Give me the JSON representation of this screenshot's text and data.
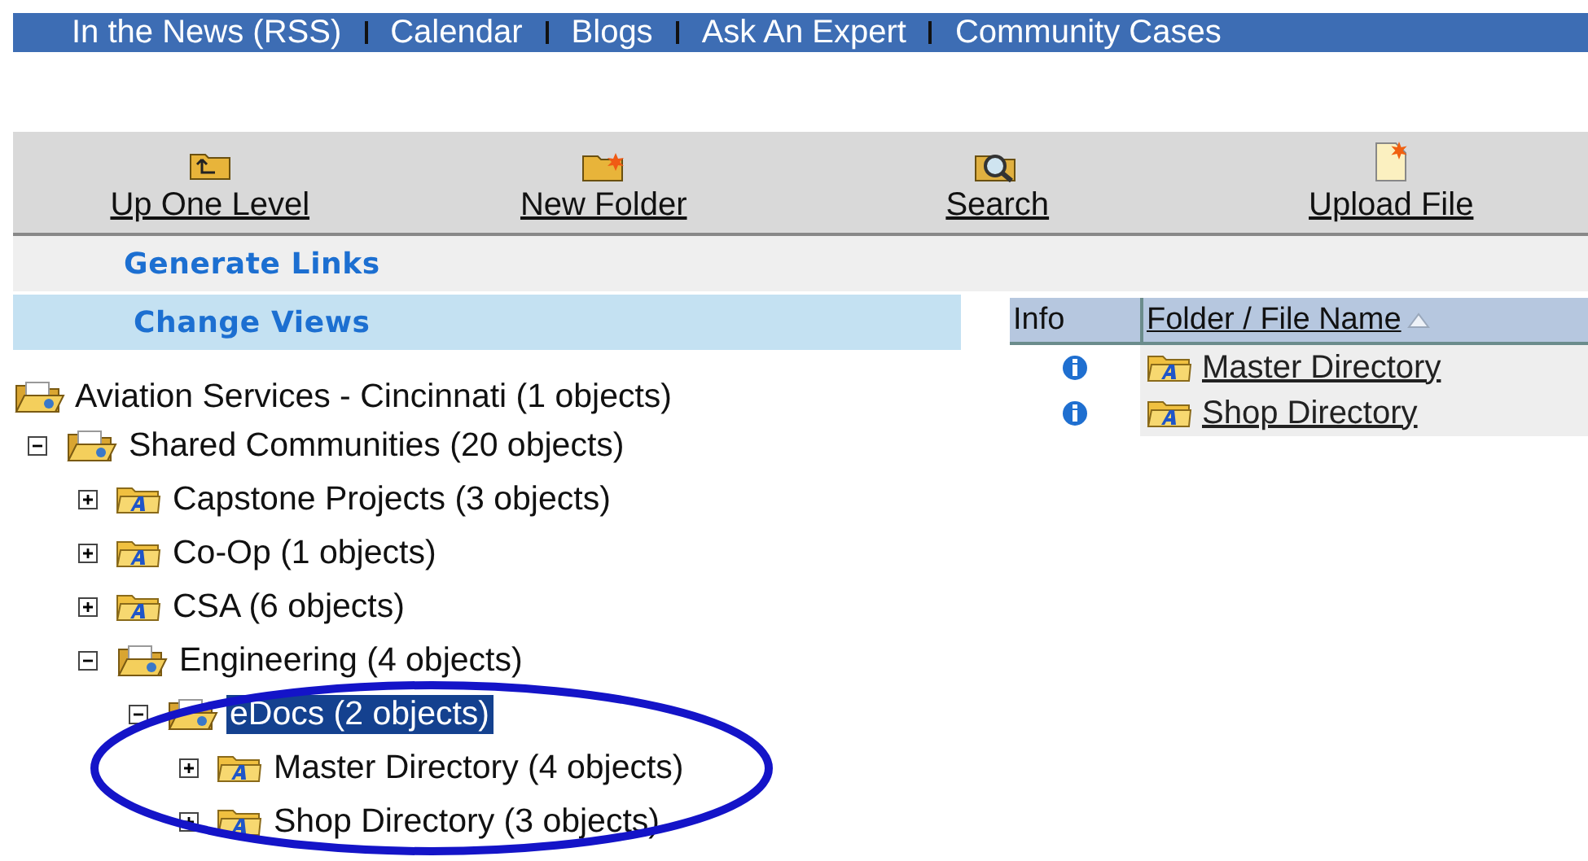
{
  "nav_links": [
    {
      "label": "In the News (RSS)"
    },
    {
      "label": "Calendar"
    },
    {
      "label": "Blogs"
    },
    {
      "label": "Ask An Expert"
    },
    {
      "label": "Community Cases"
    }
  ],
  "toolbar": [
    {
      "label": "Up One Level",
      "kind": "up"
    },
    {
      "label": "New Folder",
      "kind": "new-folder"
    },
    {
      "label": "Search",
      "kind": "search"
    },
    {
      "label": "Upload File",
      "kind": "upload"
    }
  ],
  "actions": [
    {
      "label": "Generate Links",
      "selected": false
    },
    {
      "label": "Change Views",
      "selected": true
    }
  ],
  "tree": [
    {
      "label": "Aviation Services - Cincinnati (1 objects)",
      "kind": "open-folder",
      "selected": false,
      "children": [
        {
          "label": "Shared Communities (20 objects)",
          "kind": "open-folder",
          "expanded": true,
          "selected": false,
          "children": [
            {
              "label": "Capstone Projects (3 objects)",
              "kind": "community",
              "expanded": false,
              "selected": false
            },
            {
              "label": "Co-Op (1 objects)",
              "kind": "community",
              "expanded": false,
              "selected": false
            },
            {
              "label": "CSA (6 objects)",
              "kind": "community",
              "expanded": false,
              "selected": false
            },
            {
              "label": "Engineering (4 objects)",
              "kind": "open-folder",
              "expanded": true,
              "selected": false,
              "children": [
                {
                  "label": "eDocs (2 objects)",
                  "kind": "open-folder",
                  "expanded": true,
                  "selected": true,
                  "children": [
                    {
                      "label": "Master Directory (4 objects)",
                      "kind": "community",
                      "expanded": false,
                      "selected": false
                    },
                    {
                      "label": "Shop Directory (3 objects)",
                      "kind": "community",
                      "expanded": false,
                      "selected": false
                    }
                  ]
                }
              ]
            }
          ]
        }
      ]
    }
  ],
  "table": {
    "columns": [
      {
        "label": "Info",
        "sorted": false
      },
      {
        "label": "Folder / File Name",
        "sorted": true
      }
    ],
    "rows": [
      {
        "name": "Master Directory",
        "kind": "community"
      },
      {
        "name": "Shop Directory",
        "kind": "community"
      }
    ]
  },
  "annotation": {
    "kind": "ellipse"
  }
}
